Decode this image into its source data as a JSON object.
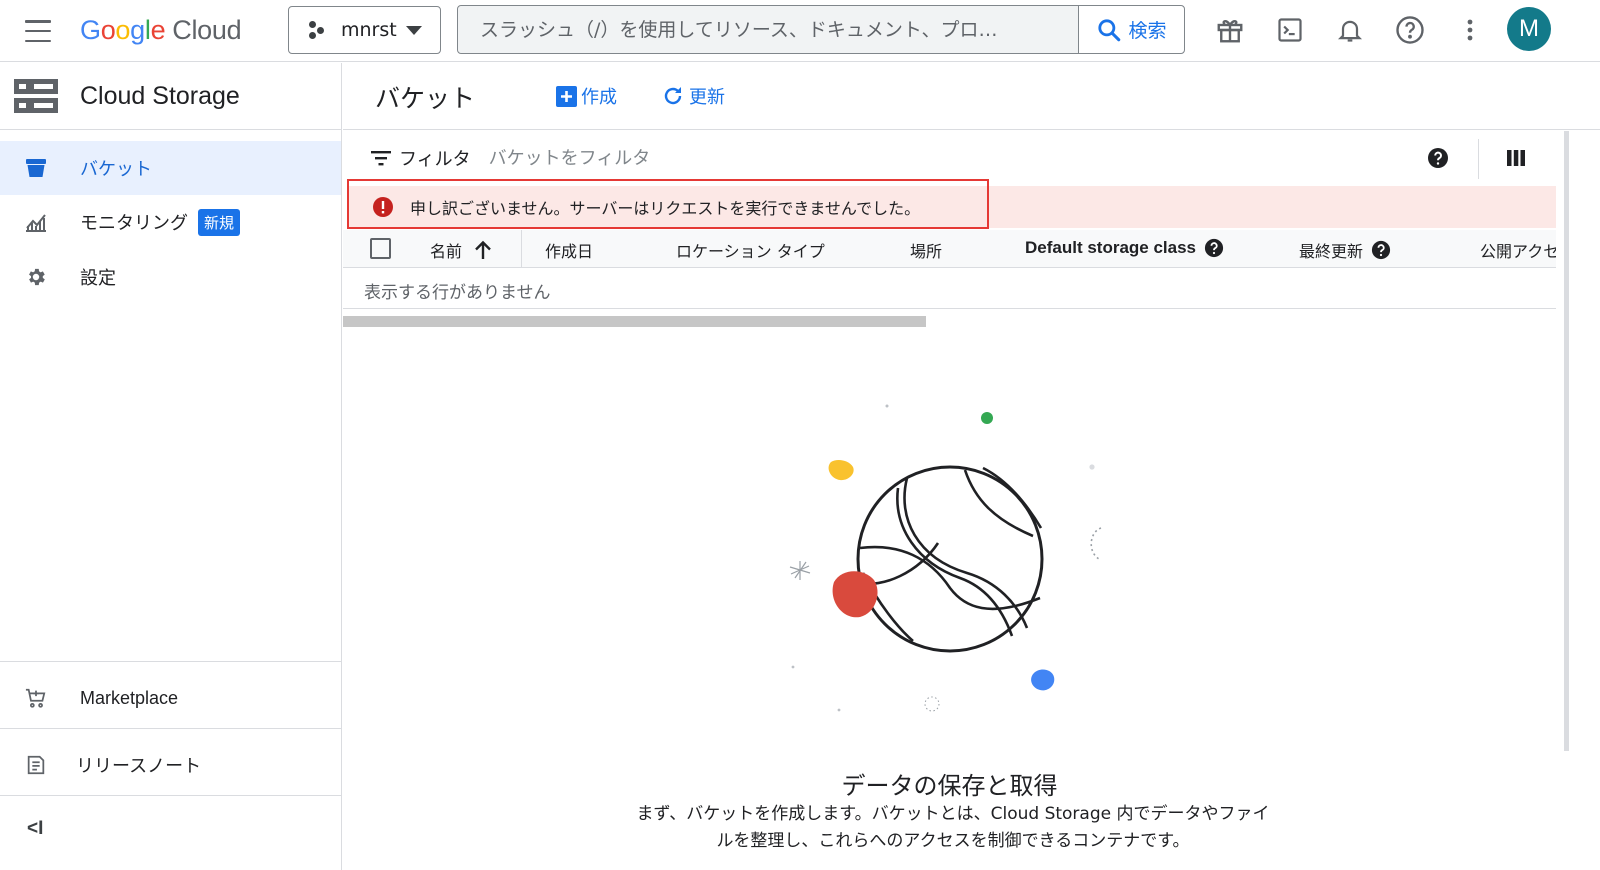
{
  "topbar": {
    "logo_letters": [
      "G",
      "o",
      "o",
      "g",
      "l",
      "e"
    ],
    "logo_suffix": "Cloud",
    "project_name": "mnrst",
    "search_placeholder": "スラッシュ（/）を使用してリソース、ドキュメント、プロ…",
    "search_button": "検索",
    "avatar_initial": "M"
  },
  "sidebar": {
    "product_title": "Cloud Storage",
    "items": [
      {
        "label": "バケット",
        "icon": "bucket-icon",
        "active": true
      },
      {
        "label": "モニタリング",
        "icon": "monitoring-icon",
        "badge": "新規"
      },
      {
        "label": "設定",
        "icon": "gear-icon"
      }
    ],
    "bottom_items": [
      {
        "label": "Marketplace",
        "icon": "cart-icon"
      },
      {
        "label": "リリースノート",
        "icon": "release-notes-icon"
      }
    ],
    "collapse_label": "<I"
  },
  "main": {
    "page_title": "バケット",
    "create_label": "作成",
    "refresh_label": "更新",
    "filter_label": "フィルタ",
    "filter_placeholder": "バケットをフィルタ",
    "error_message": "申し訳ございません。サーバーはリクエストを実行できませんでした。",
    "columns": [
      "名前",
      "作成日",
      "ロケーション タイプ",
      "場所",
      "Default storage class",
      "最終更新",
      "公開アクセ"
    ],
    "empty_row": "表示する行がありません",
    "empty_title": "データの保存と取得",
    "empty_desc": "まず、バケットを作成します。バケットとは、Cloud Storage 内でデータやファイルを整理し、これらへのアクセスを制御できるコンテナです。"
  },
  "colors": {
    "accent": "#1a73e8",
    "error": "#c5221f",
    "error_bg": "#fce8e6",
    "avatar": "#137a8a"
  }
}
